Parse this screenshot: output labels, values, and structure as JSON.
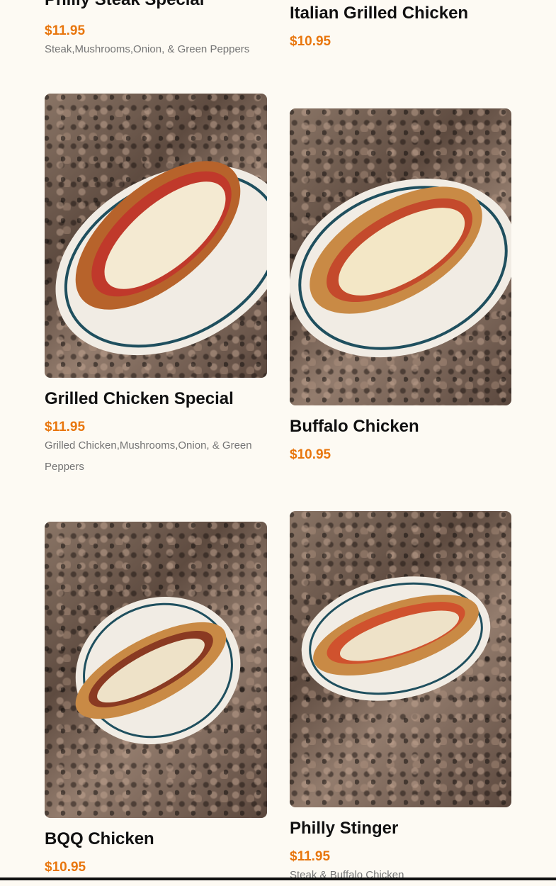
{
  "colors": {
    "background": "#fdfaf3",
    "price": "#e8760d",
    "title": "#111111",
    "description": "#757575"
  },
  "menu": {
    "items": [
      {
        "title": "Philly Steak Special",
        "price": "$11.95",
        "description": "Steak,Mushrooms,Onion, & Green Peppers",
        "image": "sandwich-photo"
      },
      {
        "title": "Italian Grilled Chicken",
        "price": "$10.95",
        "description": "",
        "image": "sandwich-photo"
      },
      {
        "title": "Grilled Chicken Special",
        "price": "$11.95",
        "description": "Grilled Chicken,Mushrooms,Onion, & Green Peppers",
        "image": "sandwich-photo"
      },
      {
        "title": "Buffalo Chicken",
        "price": "$10.95",
        "description": "",
        "image": "sandwich-photo"
      },
      {
        "title": "BQQ Chicken",
        "price": "$10.95",
        "description": "",
        "image": "sandwich-photo"
      },
      {
        "title": "Philly Stinger",
        "price": "$11.95",
        "description": "Steak & Buffalo Chicken",
        "image": "sandwich-photo"
      }
    ]
  }
}
